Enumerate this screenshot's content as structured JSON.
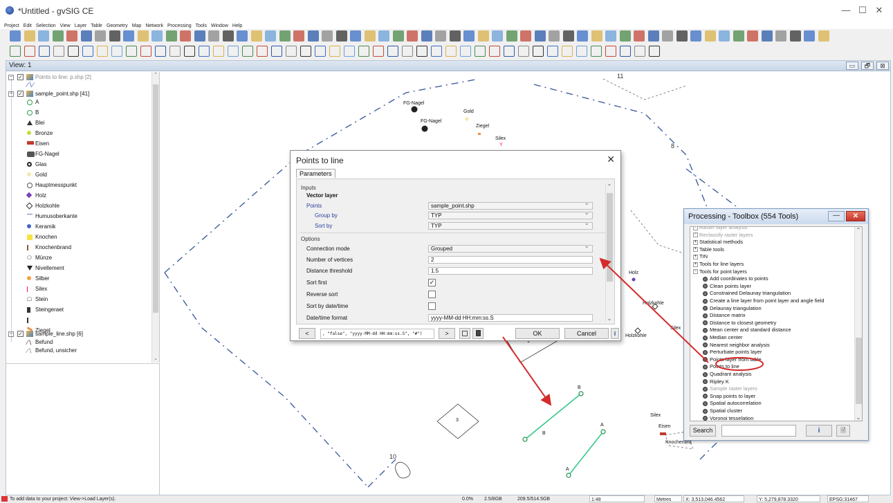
{
  "window": {
    "title": "*Untitled - gvSIG CE",
    "minimize": "—",
    "maximize": "☐",
    "close": "✕"
  },
  "menu": [
    "Project",
    "Edit",
    "Selection",
    "View",
    "Layer",
    "Table",
    "Geometry",
    "Map",
    "Network",
    "Processing",
    "Tools",
    "Window",
    "Help"
  ],
  "view": {
    "title": "View: 1",
    "btn_min": "▭",
    "btn_restore": "🗗",
    "btn_close": "⊠"
  },
  "toc": {
    "layer1": "Points to line: p.shp [2]",
    "layer2": "sample_point.shp [41]",
    "symbols": [
      "A",
      "B",
      "Blei",
      "Bronze",
      "Eisen",
      "FG-Nagel",
      "Glas",
      "Gold",
      "Hauptmesspunkt",
      "Holz",
      "Holzkohle",
      "Humusoberkante",
      "Keramik",
      "Knochen",
      "Knochenbrand",
      "Münze",
      "Nivellement",
      "Silber",
      "Silex",
      "Stein",
      "Steingeraet",
      "",
      "Ziegel"
    ],
    "layer3": "sample_line.shp [6]",
    "line_symbols": [
      "Befund",
      "Befund, unsicher"
    ]
  },
  "map_labels": {
    "fg_nagel_1": "FG-Nagel",
    "fg_nagel_2": "FG-Nagel",
    "gold": "Gold",
    "ziegel": "Ziegel",
    "silex_top": "Silex",
    "num8": "8",
    "num11": "11",
    "num1": "1",
    "num3": "3",
    "num10": "10",
    "holz": "Holz",
    "holzkohle_r": "Holzkohle",
    "holzkohle_l": "Holzkohle",
    "silex_r": "Silex",
    "silex_r2": "Silex",
    "eisen": "Eisen",
    "knochenbr": "Knochenbra",
    "pt_B1": "B",
    "pt_B2": "B",
    "pt_A1": "A",
    "pt_A2": "A"
  },
  "dialog": {
    "title": "Points to line",
    "close": "✕",
    "tab": "Parameters",
    "inputs_header": "Inputs",
    "vector_layer": "Vector layer",
    "points_label": "Points",
    "points_value": "sample_point.shp",
    "group_by_label": "Group by",
    "group_by_value": "TYP",
    "sort_by_label": "Sort by",
    "sort_by_value": "TYP",
    "options_header": "Options",
    "connection_mode_label": "Connection mode",
    "connection_mode_value": "Grouped",
    "num_vertices_label": "Number of vertices",
    "num_vertices_value": "2",
    "distance_threshold_label": "Distance threshold",
    "distance_threshold_value": "1.5",
    "sort_first_label": "Sort first",
    "sort_first_checked": "✓",
    "reverse_sort_label": "Reverse sort",
    "sort_datetime_label": "Sort by date/time",
    "datetime_format_label": "Date/time format",
    "datetime_format_value": "yyyy-MM-dd HH:mm:ss.S",
    "cmd_prev": "<",
    "cmd_text": ", \"false\", \"yyyy-MM-dd HH:mm:ss.S\", \"#\")",
    "cmd_next": ">",
    "ok": "OK",
    "cancel": "Cancel",
    "info": "i"
  },
  "toolbox": {
    "title": "Processing - Toolbox (554 Tools)",
    "min": "—",
    "close": "✕",
    "items": [
      {
        "text": "Raster layer analysis",
        "type": "group",
        "indent": 0,
        "gray": true
      },
      {
        "text": "Reclassify raster layers",
        "type": "group",
        "indent": 0,
        "gray": true
      },
      {
        "text": "Statistical methods",
        "type": "group",
        "indent": 0
      },
      {
        "text": "Table tools",
        "type": "group",
        "indent": 0
      },
      {
        "text": "TIN",
        "type": "group",
        "indent": 0
      },
      {
        "text": "Tools for line layers",
        "type": "group",
        "indent": 0
      },
      {
        "text": "Tools for point layers",
        "type": "open",
        "indent": 0
      },
      {
        "text": "Add coordinates to points",
        "type": "tool",
        "indent": 1
      },
      {
        "text": "Clean points layer",
        "type": "tool",
        "indent": 1
      },
      {
        "text": "Constrained Delaunay triangulation",
        "type": "tool",
        "indent": 1
      },
      {
        "text": "Create a line layer from point layer and angle field",
        "type": "tool",
        "indent": 1
      },
      {
        "text": "Delaunay triangulation",
        "type": "tool",
        "indent": 1
      },
      {
        "text": "Distance matrix",
        "type": "tool",
        "indent": 1
      },
      {
        "text": "Distance to closest geometry",
        "type": "tool",
        "indent": 1
      },
      {
        "text": "Mean center and standard distance",
        "type": "tool",
        "indent": 1
      },
      {
        "text": "Median center",
        "type": "tool",
        "indent": 1
      },
      {
        "text": "Nearest neighbor analysis",
        "type": "tool",
        "indent": 1
      },
      {
        "text": "Perturbate points layer",
        "type": "tool",
        "indent": 1
      },
      {
        "text": "Points layer from table",
        "type": "tool",
        "indent": 1
      },
      {
        "text": "Points to line",
        "type": "tool",
        "indent": 1,
        "highlight": true
      },
      {
        "text": "Quadrant analysis",
        "type": "tool",
        "indent": 1
      },
      {
        "text": "Ripley K",
        "type": "tool",
        "indent": 1
      },
      {
        "text": "Sample raster layers",
        "type": "tool",
        "indent": 1,
        "gray": true
      },
      {
        "text": "Snap points to layer",
        "type": "tool",
        "indent": 1
      },
      {
        "text": "Spatial autocorrelation",
        "type": "tool",
        "indent": 1
      },
      {
        "text": "Spatial cluster",
        "type": "tool",
        "indent": 1
      },
      {
        "text": "Voronoi tesselation",
        "type": "tool",
        "indent": 1
      }
    ],
    "search": "Search",
    "info": "i",
    "doc": "🗎"
  },
  "status": {
    "hint": "To add data to your project: View->Load Layer(s).",
    "mem1": "0.0%",
    "mem2": "2.5/8GB",
    "mem3": "209.5/514.5GB",
    "scale": "1:48",
    "units": "Metres",
    "x": "X: 3,513,046.4562",
    "y": "Y: 5,279,878.3320",
    "epsg": "EPSG:31467"
  },
  "colors": {
    "arrow": "#d42b2b",
    "line_green": "#38c88a",
    "gear": "#333333",
    "toolbox_border": "#7e9bbf"
  }
}
